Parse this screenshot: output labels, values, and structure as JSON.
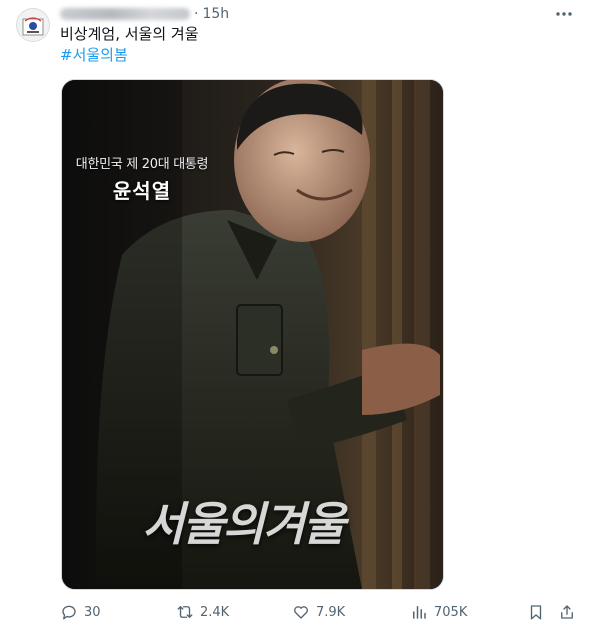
{
  "tweet": {
    "time": "15h",
    "dot": "·",
    "text": "비상계엄, 서울의 겨울",
    "hashtag": "#서울의봄"
  },
  "poster": {
    "subtitle": "대한민국 제 20대 대통령",
    "name": "윤석열",
    "title": "서울의겨울"
  },
  "actions": {
    "replies": "30",
    "retweets": "2.4K",
    "likes": "7.9K",
    "views": "705K"
  },
  "colors": {
    "accent": "#1d9bf0",
    "muted": "#536471",
    "text": "#0f1419"
  }
}
